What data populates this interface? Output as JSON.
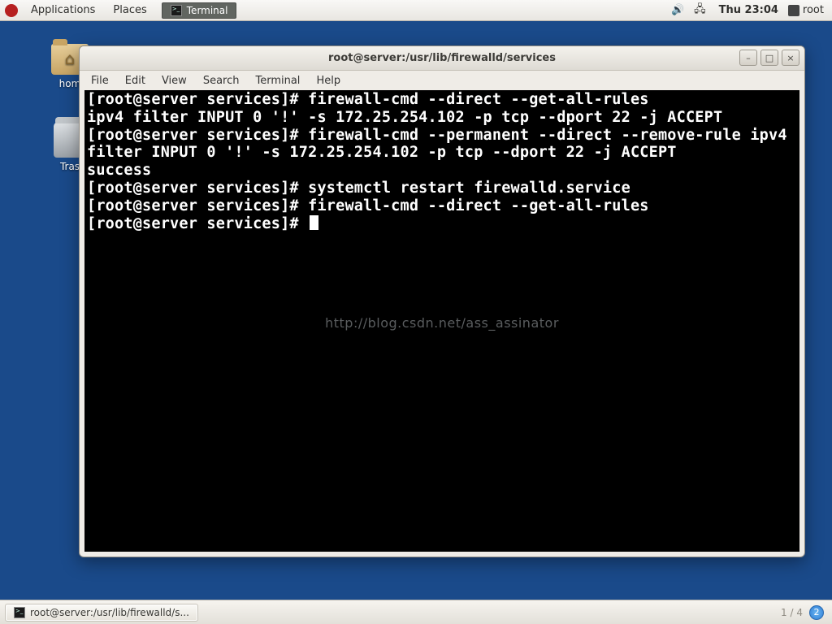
{
  "topbar": {
    "menu": {
      "applications": "Applications",
      "places": "Places"
    },
    "task_label": "Terminal",
    "clock": "Thu 23:04",
    "user": "root"
  },
  "desktop": {
    "home_label": "hom",
    "trash_label": "Tras"
  },
  "window": {
    "title": "root@server:/usr/lib/firewalld/services",
    "menus": {
      "file": "File",
      "edit": "Edit",
      "view": "View",
      "search": "Search",
      "terminal": "Terminal",
      "help": "Help"
    },
    "buttons": {
      "min": "–",
      "max": "□",
      "close": "×"
    }
  },
  "terminal": {
    "lines": [
      "[root@server services]# firewall-cmd --direct --get-all-rules",
      "ipv4 filter INPUT 0 '!' -s 172.25.254.102 -p tcp --dport 22 -j ACCEPT",
      "[root@server services]# firewall-cmd --permanent --direct --remove-rule ipv4 filter INPUT 0 '!' -s 172.25.254.102 -p tcp --dport 22 -j ACCEPT",
      "success",
      "[root@server services]# systemctl restart firewalld.service",
      "[root@server services]# firewall-cmd --direct --get-all-rules",
      "[root@server services]# "
    ],
    "watermark": "http://blog.csdn.net/ass_assinator"
  },
  "bottombar": {
    "task": "root@server:/usr/lib/firewalld/s...",
    "pager": "1 / 4",
    "workspace": "2"
  }
}
